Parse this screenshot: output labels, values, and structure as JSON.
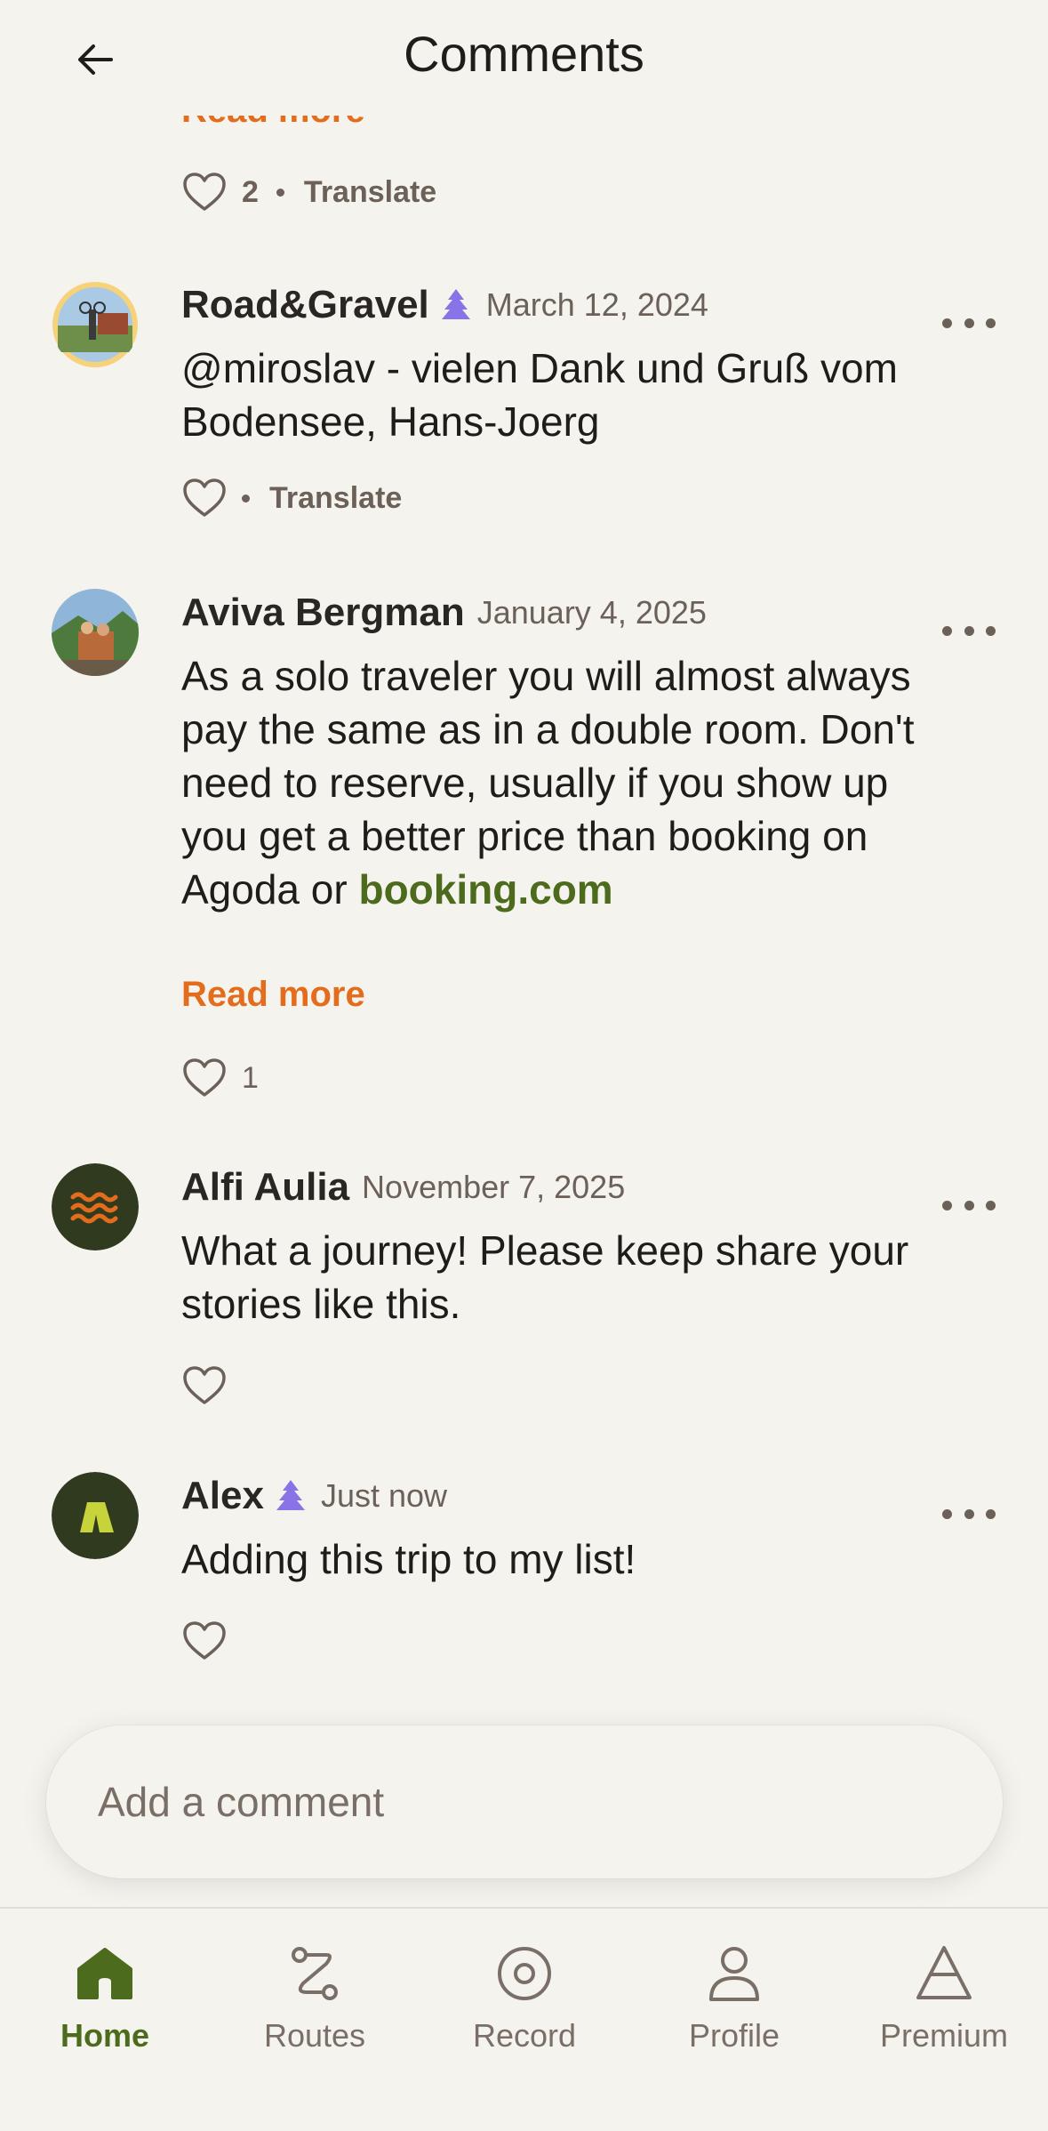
{
  "header": {
    "title": "Comments"
  },
  "previous_comment": {
    "read_more": "Read more",
    "likes": "2",
    "translate": "Translate"
  },
  "comments": [
    {
      "name": "Road&Gravel",
      "premium": true,
      "date": "March 12, 2024",
      "text": "@miroslav  - vielen Dank und Gruß vom Bodensee, Hans-Joerg",
      "likes": "",
      "translate": "Translate"
    },
    {
      "name": "Aviva Bergman",
      "premium": false,
      "date": "January 4, 2025",
      "text": "As a solo traveler you will almost always pay the same as in a double room. Don't need to reserve, usually if you show up you get a better price than booking on Agoda or ",
      "link": "booking.com",
      "read_more": "Read more",
      "likes": "1"
    },
    {
      "name": "Alfi Aulia",
      "premium": false,
      "date": "November 7, 2025",
      "text": "What a journey! Please keep share your stories like this.",
      "likes": ""
    },
    {
      "name": "Alex",
      "premium": true,
      "date": "Just now",
      "text": "Adding this trip to my list!",
      "likes": ""
    }
  ],
  "comment_input": {
    "placeholder": "Add a comment"
  },
  "nav": {
    "items": [
      {
        "label": "Home",
        "icon": "home-icon",
        "active": true
      },
      {
        "label": "Routes",
        "icon": "routes-icon",
        "active": false
      },
      {
        "label": "Record",
        "icon": "record-icon",
        "active": false
      },
      {
        "label": "Profile",
        "icon": "profile-icon",
        "active": false
      },
      {
        "label": "Premium",
        "icon": "premium-icon",
        "active": false
      }
    ]
  },
  "colors": {
    "background": "#f5f3ee",
    "accent_green": "#4c6b1c",
    "accent_orange": "#e36d1c",
    "premium_purple": "#8a73e6",
    "muted_text": "#6b6158"
  }
}
